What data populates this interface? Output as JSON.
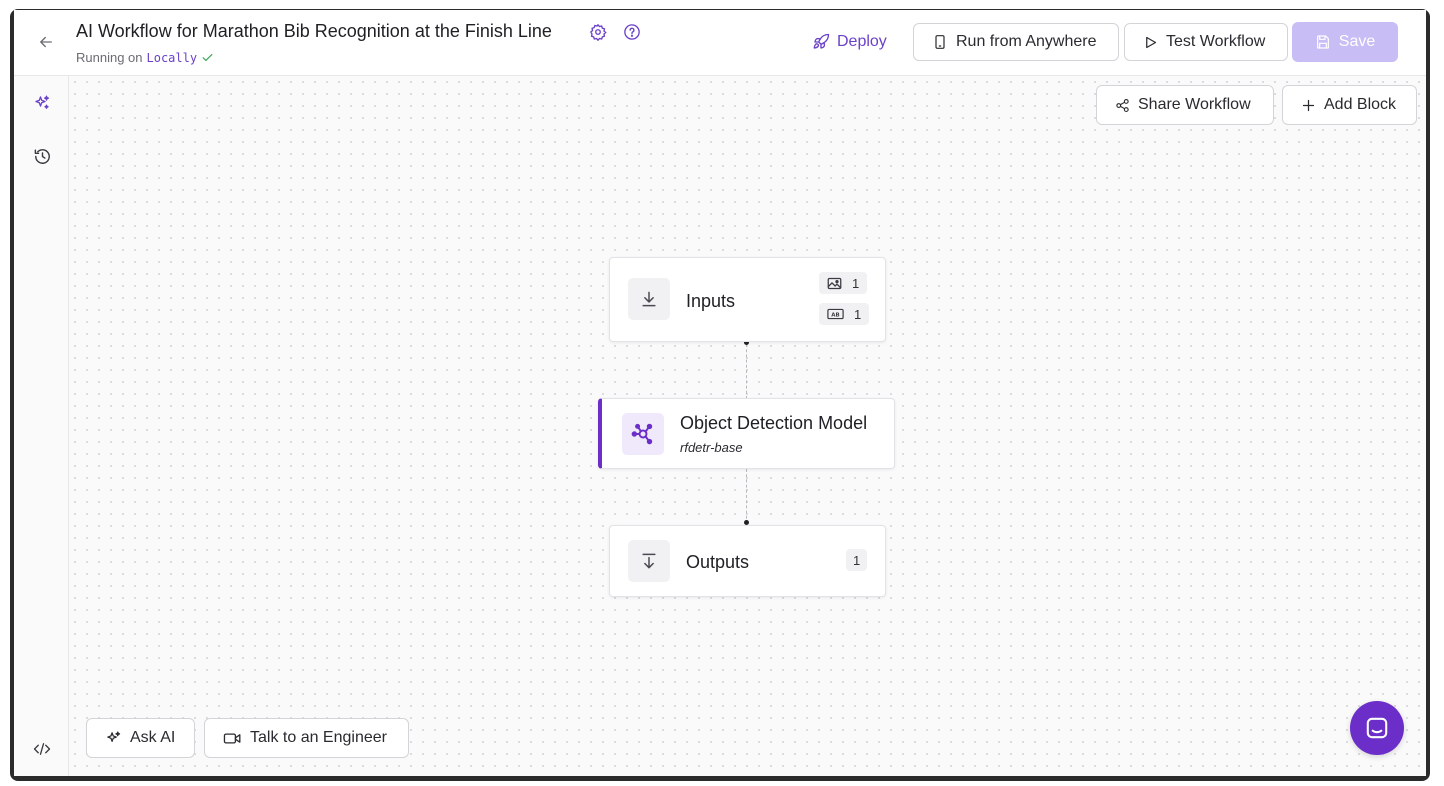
{
  "header": {
    "title": "AI Workflow for Marathon Bib Recognition at the Finish Line",
    "running_prefix": "Running on",
    "running_target": "Locally",
    "deploy_label": "Deploy",
    "run_anywhere_label": "Run from Anywhere",
    "test_workflow_label": "Test Workflow",
    "save_label": "Save"
  },
  "toolbar": {
    "share_label": "Share Workflow",
    "add_block_label": "Add Block"
  },
  "nodes": {
    "inputs": {
      "label": "Inputs",
      "image_count": "1",
      "text_count": "1"
    },
    "model": {
      "label": "Object Detection Model",
      "model_id": "rfdetr-base"
    },
    "outputs": {
      "label": "Outputs",
      "count": "1"
    }
  },
  "bottom": {
    "ask_ai_label": "Ask AI",
    "talk_engineer_label": "Talk to an Engineer"
  },
  "colors": {
    "accent": "#6b41c9",
    "save_disabled": "#c9bdf5",
    "chat_fab": "#6b2ec9"
  }
}
